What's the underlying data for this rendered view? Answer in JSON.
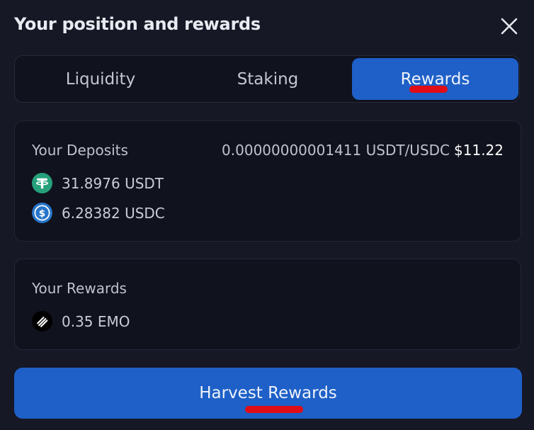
{
  "modal": {
    "title": "Your position and rewards"
  },
  "tabs": [
    {
      "label": "Liquidity"
    },
    {
      "label": "Staking"
    },
    {
      "label": "Rewards"
    }
  ],
  "deposits": {
    "label": "Your Deposits",
    "ratio": "0.00000000001411 USDT/USDC",
    "usd_value": "$11.22",
    "tokens": [
      {
        "amount": "31.8976 USDT",
        "icon": "usdt-icon",
        "color": "#26a17b"
      },
      {
        "amount": "6.28382 USDC",
        "icon": "usdc-icon",
        "color": "#2775ca"
      }
    ]
  },
  "rewards": {
    "label": "Your Rewards",
    "tokens": [
      {
        "amount": "0.35 EMO",
        "icon": "emo-icon",
        "color": "#000000"
      }
    ]
  },
  "actions": {
    "harvest_label": "Harvest Rewards"
  },
  "colors": {
    "background": "#161826",
    "card": "#10121d",
    "accent": "#1e60c7",
    "highlight_mark": "#e00d16"
  }
}
